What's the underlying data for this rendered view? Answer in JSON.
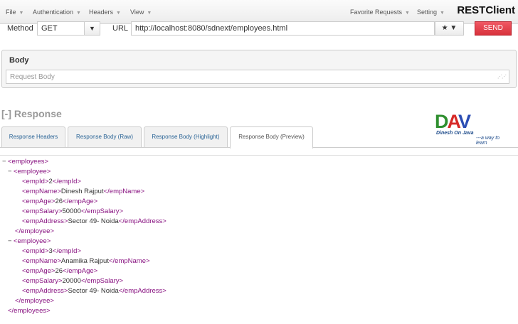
{
  "menubar": {
    "items": [
      "File",
      "Authentication",
      "Headers",
      "View",
      "Favorite Requests",
      "Setting"
    ],
    "brand": "RESTClient"
  },
  "request": {
    "method_label": "Method",
    "method_value": "GET",
    "url_label": "URL",
    "url_value": "http://localhost:8080/sdnext/employees.html",
    "fav_icon": "star-icon",
    "send_label": "SEND"
  },
  "body": {
    "title": "Body",
    "placeholder": "Request Body"
  },
  "response": {
    "title": "[-] Response",
    "tabs": [
      "Response Headers",
      "Response Body (Raw)",
      "Response Body (Highlight)",
      "Response Body (Preview)"
    ],
    "active_tab": 3
  },
  "logo": {
    "letters": [
      "D",
      "A",
      "V"
    ],
    "tagline": "Dinesh On Java",
    "slogan": "---a way to learn"
  },
  "xml": {
    "root": "employees",
    "item_tag": "employee",
    "employees": [
      [
        {
          "tag": "empId",
          "value": "2"
        },
        {
          "tag": "empName",
          "value": "Dinesh Rajput"
        },
        {
          "tag": "empAge",
          "value": "26"
        },
        {
          "tag": "empSalary",
          "value": "50000"
        },
        {
          "tag": "empAddress",
          "value": "Sector 49- Noida"
        }
      ],
      [
        {
          "tag": "empId",
          "value": "3"
        },
        {
          "tag": "empName",
          "value": "Anamika Rajput"
        },
        {
          "tag": "empAge",
          "value": "26"
        },
        {
          "tag": "empSalary",
          "value": "20000"
        },
        {
          "tag": "empAddress",
          "value": "Sector 49- Noida"
        }
      ]
    ]
  }
}
